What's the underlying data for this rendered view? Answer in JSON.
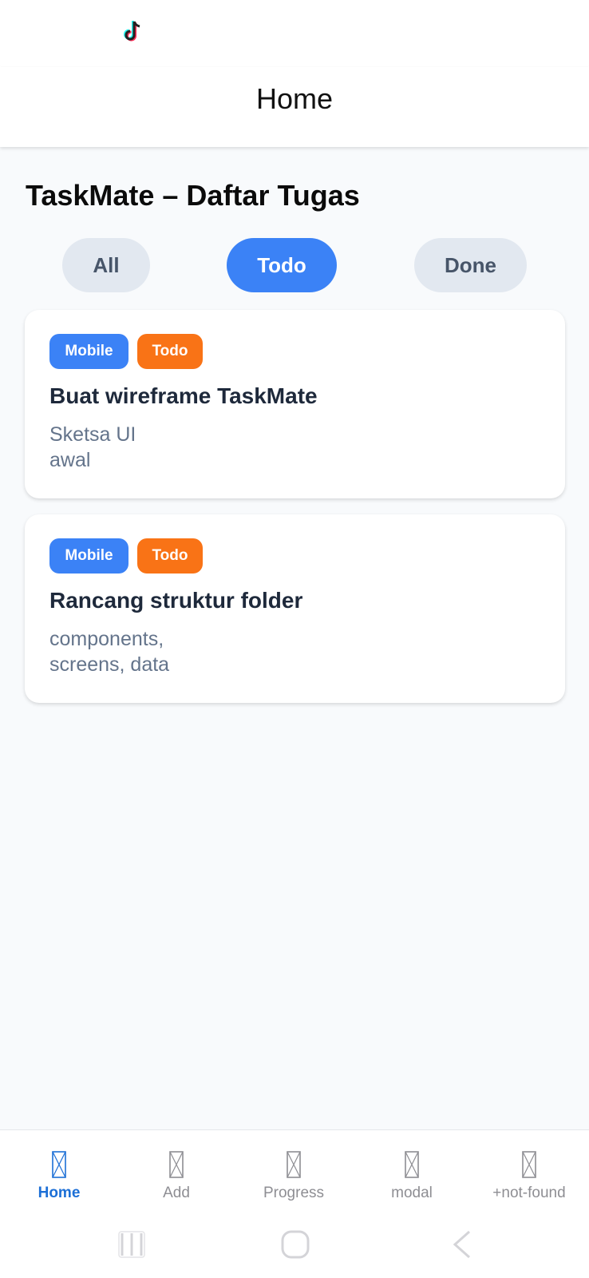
{
  "header": {
    "title": "Home"
  },
  "page": {
    "title": "TaskMate – Daftar Tugas"
  },
  "filters": {
    "all": "All",
    "todo": "Todo",
    "done": "Done",
    "selected": "Todo"
  },
  "tasks": [
    {
      "category": "Mobile",
      "status": "Todo",
      "title": "Buat wireframe TaskMate",
      "desc_lines": [
        "Sketsa UI",
        "awal"
      ]
    },
    {
      "category": "Mobile",
      "status": "Todo",
      "title": "Rancang struktur folder",
      "desc_lines": [
        "components,",
        "screens, data"
      ]
    }
  ],
  "tabs": [
    {
      "label": "Home",
      "icon": "placeholder-icon",
      "active": true
    },
    {
      "label": "Add",
      "icon": "placeholder-icon",
      "active": false
    },
    {
      "label": "Progress",
      "icon": "placeholder-icon",
      "active": false
    },
    {
      "label": "modal",
      "icon": "placeholder-icon",
      "active": false
    },
    {
      "label": "+not-found",
      "icon": "placeholder-icon",
      "active": false
    }
  ],
  "colors": {
    "accent": "#3b82f6",
    "status_todo": "#f97316",
    "tab_active": "#1c6fd6",
    "filter_inactive": "#e2e8f0"
  },
  "status_bar": {
    "icon": "tiktok-icon"
  },
  "system_nav": {
    "icons": [
      "recent-apps-icon",
      "home-circle-icon",
      "back-icon"
    ]
  }
}
